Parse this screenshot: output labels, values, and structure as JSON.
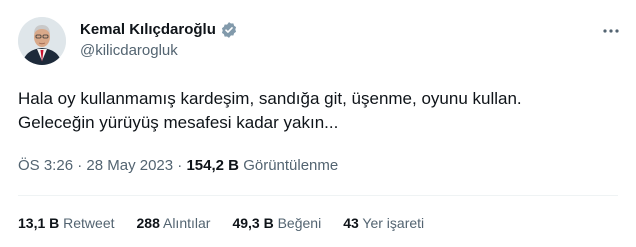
{
  "author": {
    "display_name": "Kemal Kılıçdaroğlu",
    "handle": "@kilicdarogluk",
    "verified_color": "#829aab"
  },
  "tweet": {
    "lines": [
      "Hala oy kullanmamış kardeşim, sandığa git, üşenme, oyunu kullan.",
      "Geleceğin yürüyüş mesafesi kadar yakın..."
    ]
  },
  "meta": {
    "time": "ÖS 3:26",
    "separator": "·",
    "date": "28 May 2023",
    "views_count": "154,2 B",
    "views_label": "Görüntülenme"
  },
  "stats": [
    {
      "count": "13,1 B",
      "label": "Retweet"
    },
    {
      "count": "288",
      "label": "Alıntılar"
    },
    {
      "count": "49,3 B",
      "label": "Beğeni"
    },
    {
      "count": "43",
      "label": "Yer işareti"
    }
  ],
  "icons": {
    "more": "more-options-icon",
    "verified": "verified-badge-icon"
  }
}
